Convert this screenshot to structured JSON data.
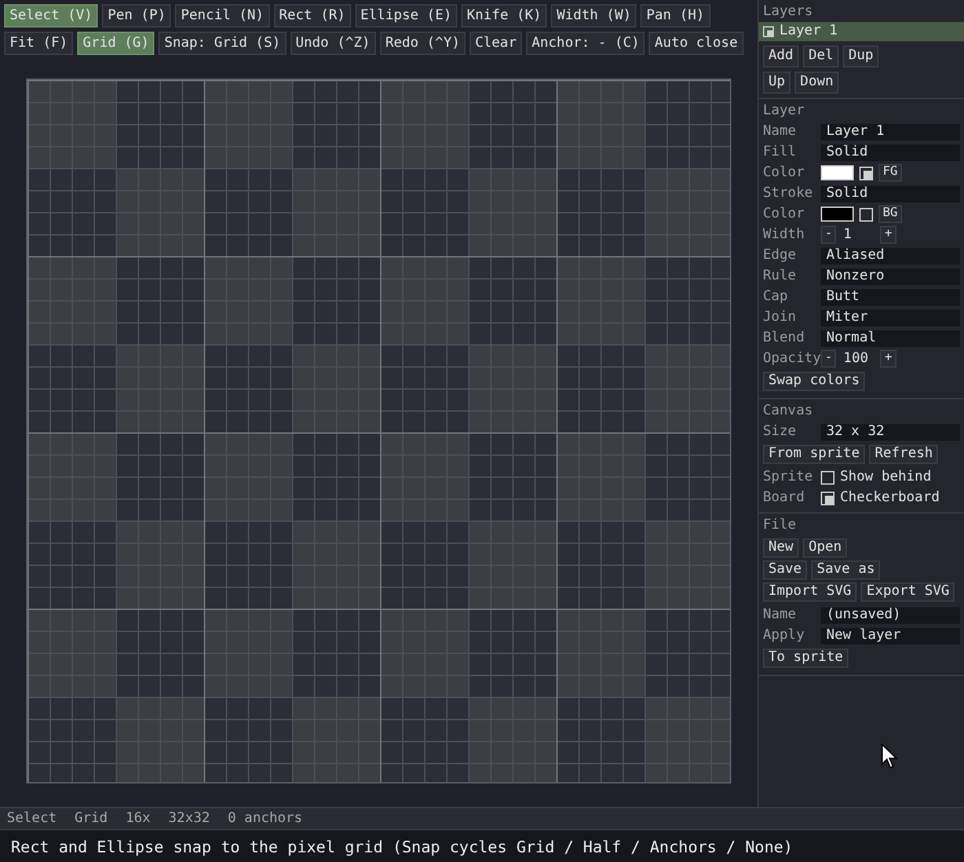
{
  "toolbar": {
    "rows": [
      [
        {
          "label": "Select (V)",
          "selected": true
        },
        {
          "label": "Pen (P)",
          "selected": false
        },
        {
          "label": "Pencil (N)",
          "selected": false
        },
        {
          "label": "Rect (R)",
          "selected": false
        },
        {
          "label": "Ellipse (E)",
          "selected": false
        },
        {
          "label": "Knife (K)",
          "selected": false
        },
        {
          "label": "Width (W)",
          "selected": false
        },
        {
          "label": "Pan (H)",
          "selected": false
        }
      ],
      [
        {
          "label": "Fit (F)",
          "selected": false
        },
        {
          "label": "Grid (G)",
          "selected": true
        },
        {
          "label": "Snap: Grid (S)",
          "selected": false
        },
        {
          "label": "Undo (^Z)",
          "selected": false
        },
        {
          "label": "Redo (^Y)",
          "selected": false
        },
        {
          "label": "Clear",
          "selected": false
        },
        {
          "label": "Anchor: - (C)",
          "selected": false
        },
        {
          "label": "Auto close",
          "selected": false
        }
      ]
    ]
  },
  "layers": {
    "title": "Layers",
    "items": [
      {
        "label": "Layer 1",
        "visible": true,
        "selected": true
      }
    ],
    "button_rows": [
      [
        "Add",
        "Del",
        "Dup"
      ],
      [
        "Up",
        "Down"
      ]
    ]
  },
  "sections": [
    {
      "title": "Layer",
      "rows": [
        {
          "kind": "field",
          "label": "Name",
          "value": "Layer 1"
        },
        {
          "kind": "field",
          "label": "Fill",
          "value": "Solid"
        },
        {
          "kind": "color",
          "label": "Color",
          "color": "#ffffff",
          "checked": true,
          "button": "FG"
        },
        {
          "kind": "field",
          "label": "Stroke",
          "value": "Solid"
        },
        {
          "kind": "color",
          "label": "Color",
          "color": "#000000",
          "checked": false,
          "button": "BG"
        },
        {
          "kind": "stepper",
          "label": "Width",
          "minus": "-",
          "value": "1",
          "plus": "+"
        },
        {
          "kind": "field",
          "label": "Edge",
          "value": "Aliased"
        },
        {
          "kind": "field",
          "label": "Rule",
          "value": "Nonzero"
        },
        {
          "kind": "field",
          "label": "Cap",
          "value": "Butt"
        },
        {
          "kind": "field",
          "label": "Join",
          "value": "Miter"
        },
        {
          "kind": "field",
          "label": "Blend",
          "value": "Normal"
        },
        {
          "kind": "stepper",
          "label": "Opacity",
          "minus": "-",
          "value": "100",
          "plus": "+"
        },
        {
          "kind": "buttons",
          "buttons": [
            "Swap colors"
          ]
        }
      ]
    },
    {
      "title": "Canvas",
      "rows": [
        {
          "kind": "field",
          "label": "Size",
          "value": "32 x 32"
        },
        {
          "kind": "buttons",
          "buttons": [
            "From sprite",
            "Refresh"
          ]
        },
        {
          "kind": "check",
          "label": "Sprite",
          "text": "Show behind",
          "checked": false
        },
        {
          "kind": "check",
          "label": "Board",
          "text": "Checkerboard",
          "checked": true
        }
      ]
    },
    {
      "title": "File",
      "rows": [
        {
          "kind": "buttons",
          "buttons": [
            "New",
            "Open"
          ]
        },
        {
          "kind": "buttons",
          "buttons": [
            "Save",
            "Save as"
          ]
        },
        {
          "kind": "buttons",
          "buttons": [
            "Import SVG",
            "Export SVG"
          ]
        },
        {
          "kind": "field",
          "label": "Name",
          "value": "(unsaved)"
        },
        {
          "kind": "field",
          "label": "Apply",
          "value": "New layer"
        },
        {
          "kind": "buttons",
          "buttons": [
            "To sprite"
          ]
        }
      ]
    }
  ],
  "status_bar": [
    "Select",
    "Grid",
    "16x",
    "32x32",
    "0 anchors"
  ],
  "hint": "Rect and Ellipse snap to the pixel grid (Snap cycles Grid / Half / Anchors / None)"
}
